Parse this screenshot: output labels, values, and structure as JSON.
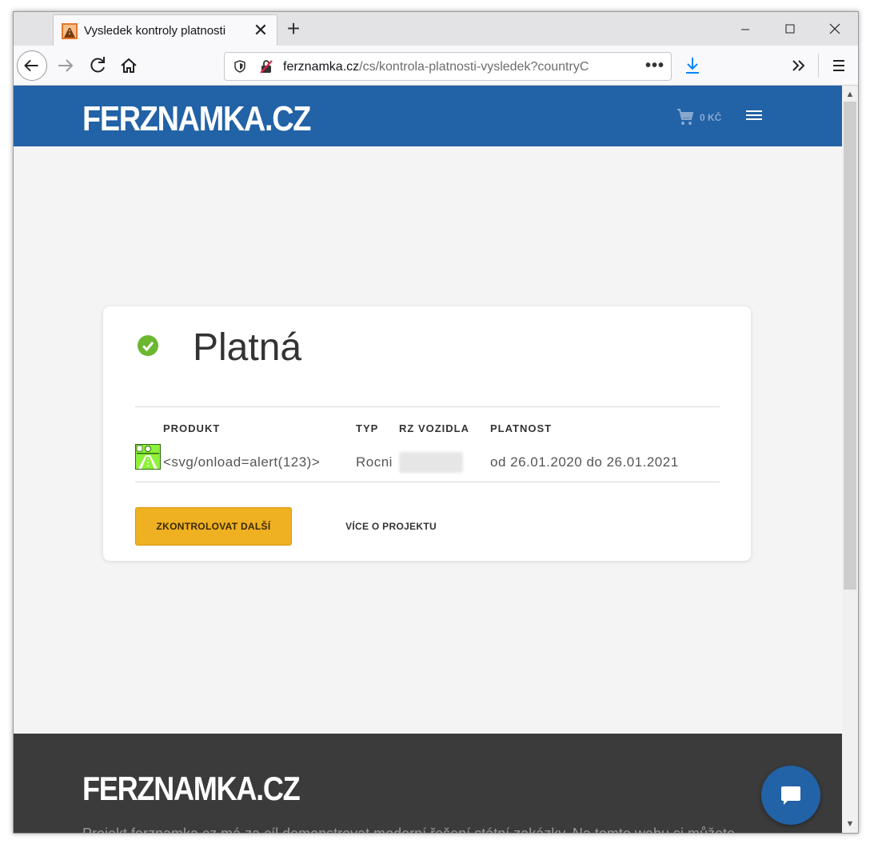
{
  "browser": {
    "tab_title": "Vysledek kontroly platnosti",
    "url_host": "ferznamka.cz",
    "url_path": "/cs/kontrola-platnosti-vysledek?countryC"
  },
  "site": {
    "logo": "FERZNAMKA.CZ",
    "cart_amount": "0 KČ",
    "accent_color": "#2262a6"
  },
  "result": {
    "status": "Platná",
    "status_color": "#6bb72f",
    "columns": [
      "PRODUKT",
      "TYP",
      "RZ VOZIDLA",
      "PLATNOST"
    ],
    "row": {
      "product": "<svg/onload=alert(123)>",
      "type": "Rocni",
      "validity": "od 26.01.2020 do 26.01.2021"
    },
    "check_again_label": "ZKONTROLOVAT DALŠÍ",
    "more_label": "VÍCE O PROJEKTU"
  },
  "footer": {
    "logo": "FERZNAMKA.CZ",
    "text": "Projekt ferznamka.cz má za cíl demonstrovat moderní řešení státní zakázky. Na tomto webu si můžete"
  }
}
